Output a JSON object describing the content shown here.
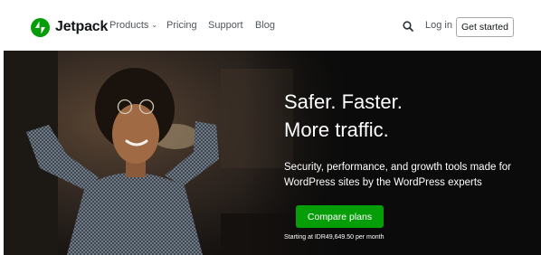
{
  "nav": {
    "brand": "Jetpack",
    "links": [
      {
        "label": "Products",
        "has_dropdown": true
      },
      {
        "label": "Pricing"
      },
      {
        "label": "Support"
      },
      {
        "label": "Blog"
      }
    ],
    "search_icon": "search-icon",
    "login_label": "Log in",
    "get_started_label": "Get started"
  },
  "hero": {
    "headline_line1": "Safer. Faster.",
    "headline_line2": "More traffic.",
    "subtext": "Security, performance, and growth tools made for WordPress sites by the WordPress experts",
    "cta_label": "Compare plans",
    "price_note": "Starting at IDR49,649.50 per month"
  },
  "colors": {
    "brand_green": "#069e08",
    "hero_background": "#0b0b0b",
    "nav_text": "#50575e"
  }
}
